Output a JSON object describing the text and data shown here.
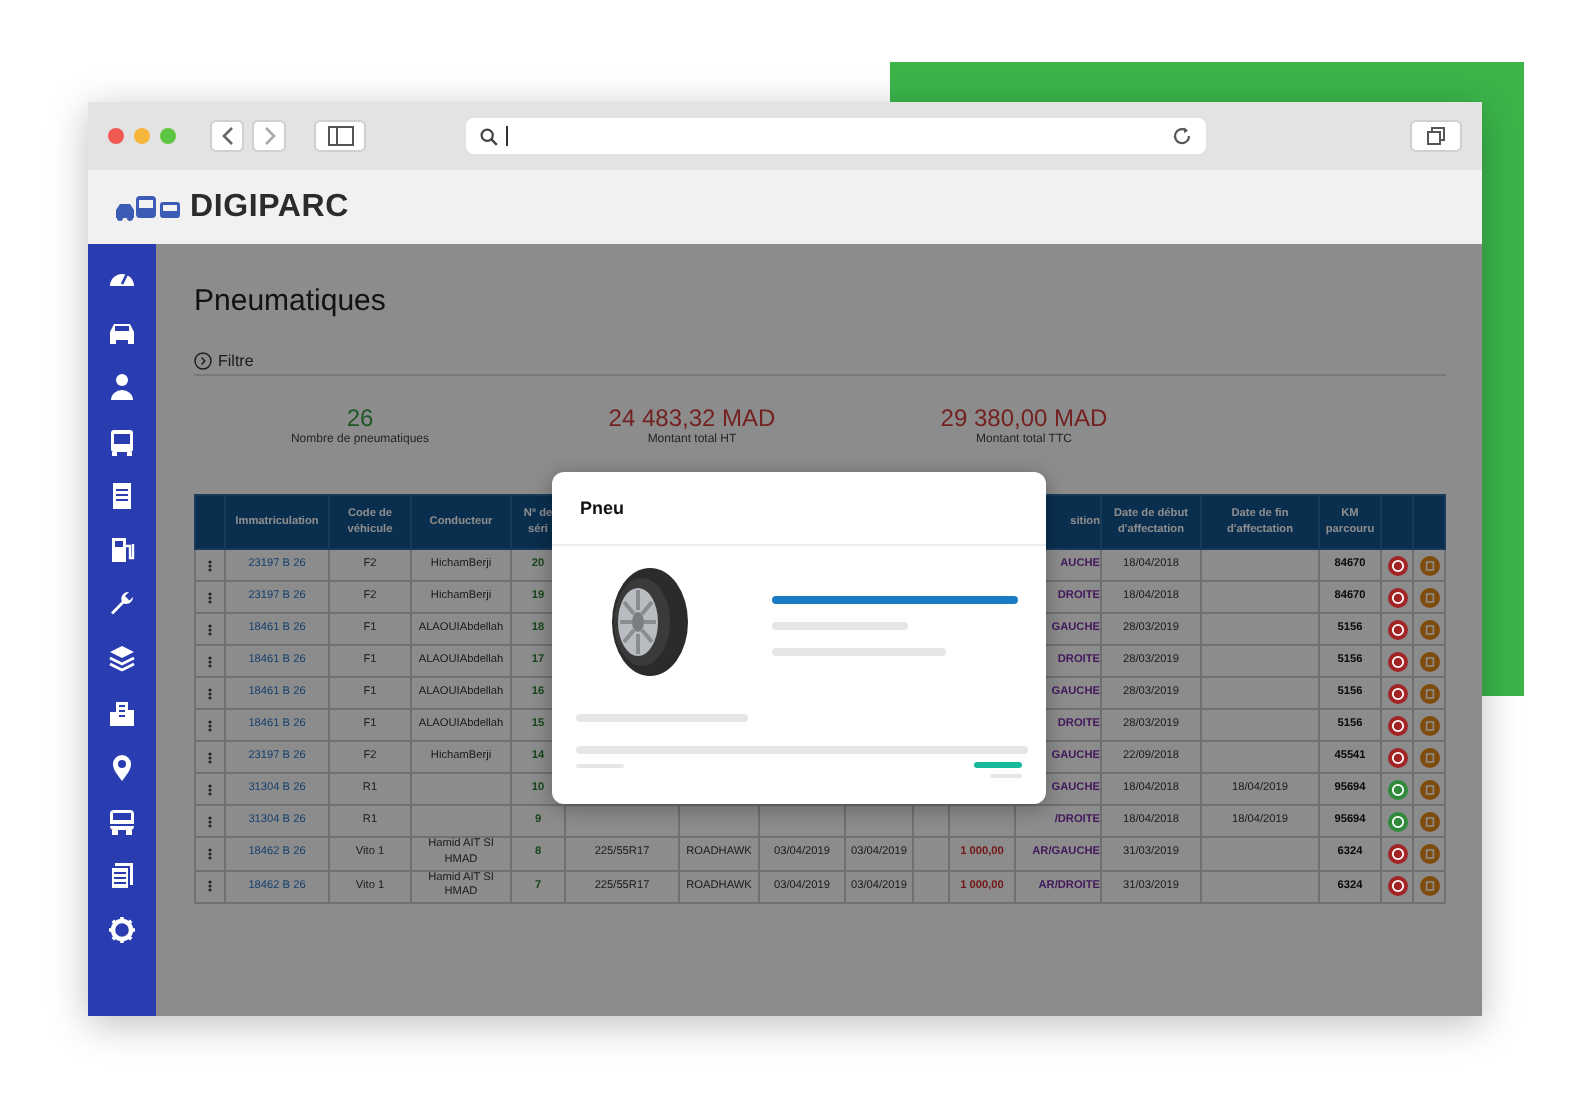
{
  "app": {
    "logo": "DIGIPARC"
  },
  "page": {
    "title": "Pneumatiques",
    "filter": "Filtre"
  },
  "stats": [
    {
      "value": "26",
      "label": "Nombre de pneumatiques",
      "kind": "count"
    },
    {
      "value": "24 483,32 MAD",
      "label": "Montant total HT",
      "kind": "amount"
    },
    {
      "value": "29 380,00 MAD",
      "label": "Montant total TTC",
      "kind": "amount"
    }
  ],
  "table": {
    "columns": {
      "immatriculation": "Immatriculation",
      "code_vehicule": "Code de véhicule",
      "conducteur": "Conducteur",
      "numero_serie": "N° de séri",
      "position": "sition",
      "date_debut": "Date de début d'affectation",
      "date_fin": "Date de fin d'affectation",
      "km": "KM parcouru"
    },
    "rows": [
      {
        "plate": "23197 B 26",
        "code": "F2",
        "driver": "HichamBerji",
        "serial": "20",
        "position": "AUCHE",
        "start": "18/04/2018",
        "km": "84670",
        "color": "#a32424"
      },
      {
        "plate": "23197 B 26",
        "code": "F2",
        "driver": "HichamBerji",
        "serial": "19",
        "position": "DROITE",
        "start": "18/04/2018",
        "km": "84670",
        "color": "#a32424"
      },
      {
        "plate": "18461 B 26",
        "code": "F1",
        "driver": "ALAOUIAbdellah",
        "serial": "18",
        "position": "GAUCHE",
        "start": "28/03/2019",
        "km": "5156",
        "color": "#a32424"
      },
      {
        "plate": "18461 B 26",
        "code": "F1",
        "driver": "ALAOUIAbdellah",
        "serial": "17",
        "position": "DROITE",
        "start": "28/03/2019",
        "km": "5156",
        "color": "#a32424"
      },
      {
        "plate": "18461 B 26",
        "code": "F1",
        "driver": "ALAOUIAbdellah",
        "serial": "16",
        "position": "GAUCHE",
        "start": "28/03/2019",
        "km": "5156",
        "color": "#a32424"
      },
      {
        "plate": "18461 B 26",
        "code": "F1",
        "driver": "ALAOUIAbdellah",
        "serial": "15",
        "position": "DROITE",
        "start": "28/03/2019",
        "km": "5156",
        "color": "#a32424"
      },
      {
        "plate": "23197 B 26",
        "code": "F2",
        "driver": "HichamBerji",
        "serial": "14",
        "position": "GAUCHE",
        "start": "22/09/2018",
        "km": "45541",
        "color": "#a32424"
      },
      {
        "plate": "31304 B 26",
        "code": "R1",
        "serial": "10",
        "position": "GAUCHE",
        "start": "18/04/2018",
        "end": "18/04/2019",
        "km": "95694",
        "color": "#2f8a3c"
      },
      {
        "plate": "31304 B 26",
        "code": "R1",
        "serial": "9",
        "position": "/DROITE",
        "start": "18/04/2018",
        "end": "18/04/2019",
        "km": "95694",
        "color": "#2f8a3c"
      },
      {
        "plate": "18462 B 26",
        "code": "Vito 1",
        "driver": "Hamid AIT SI HMAD",
        "serial": "8",
        "dimension": "225/55R17",
        "brand": "ROADHAWK",
        "date_1": "03/04/2019",
        "date_2": "03/04/2019",
        "amount": "1 000,00",
        "position": "AR/GAUCHE",
        "start": "31/03/2019",
        "km": "6324",
        "color": "#a32424"
      },
      {
        "plate": "18462 B 26",
        "code": "Vito 1",
        "driver": "Hamid AIT SI HMAD",
        "serial": "7",
        "dimension": "225/55R17",
        "brand": "ROADHAWK",
        "date_1": "03/04/2019",
        "date_2": "03/04/2019",
        "amount": "1 000,00",
        "position": "AR/DROITE",
        "start": "31/03/2019",
        "km": "6324",
        "color": "#a32424"
      }
    ]
  },
  "modal": {
    "title": "Pneu"
  }
}
